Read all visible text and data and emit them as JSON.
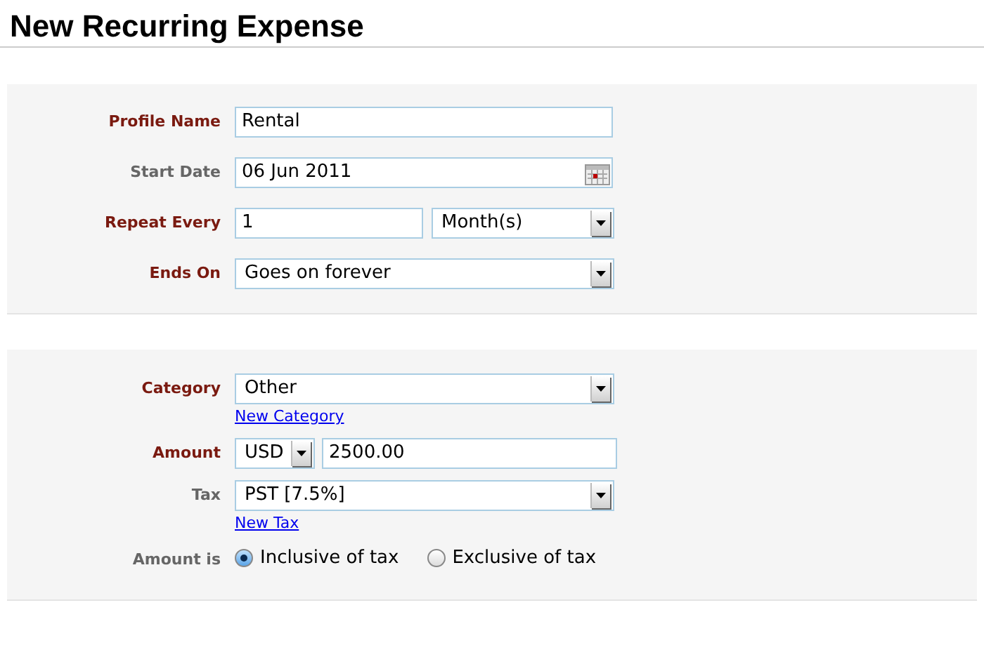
{
  "title": "New Recurring Expense",
  "sections": [
    {
      "fields": [
        {
          "kind": "text",
          "label": "Profile Name",
          "required": true,
          "value": "Rental"
        },
        {
          "kind": "date",
          "label": "Start Date",
          "required": false,
          "value": "06 Jun 2011"
        },
        {
          "kind": "repeat",
          "label": "Repeat Every",
          "required": true,
          "value": "1",
          "unit": "Month(s)"
        },
        {
          "kind": "select",
          "label": "Ends On",
          "required": true,
          "value": "Goes on forever"
        }
      ]
    },
    {
      "fields": [
        {
          "kind": "select",
          "label": "Category",
          "required": true,
          "value": "Other",
          "link": "New Category"
        },
        {
          "kind": "money",
          "label": "Amount",
          "required": true,
          "currency": "USD",
          "value": "2500.00"
        },
        {
          "kind": "select",
          "label": "Tax",
          "required": false,
          "value": "PST [7.5%]",
          "link": "New Tax"
        },
        {
          "kind": "radio",
          "label": "Amount is",
          "required": false,
          "options": [
            {
              "label": "Inclusive of tax",
              "selected": true
            },
            {
              "label": "Exclusive of tax",
              "selected": false
            }
          ]
        }
      ]
    }
  ]
}
